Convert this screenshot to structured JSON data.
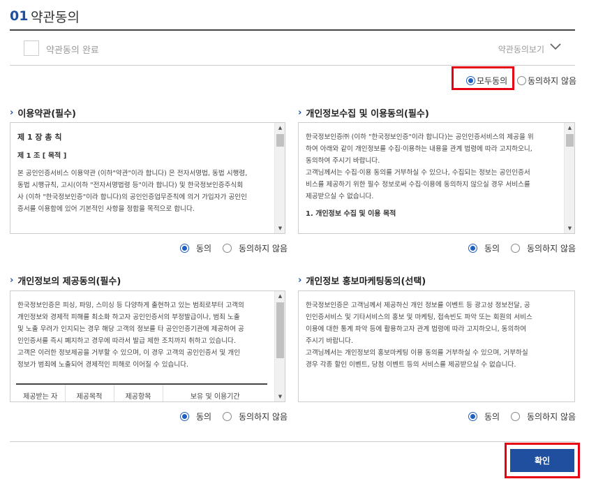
{
  "header": {
    "num": "01",
    "title": "약관동의"
  },
  "agree_row": {
    "label": "약관동의 완료",
    "view_label": "약관동의보기"
  },
  "all": {
    "agree": "모두동의",
    "disagree": "동의하지 않음"
  },
  "terms": {
    "title": "이용약관(필수)",
    "lines": [
      "제 1 장 총 칙",
      "제 1 조 [ 목적 ]",
      "본 공인인증서비스 이용약관 (이하\"약관\"이라 합니다) 은 전자서명법, 동법 시행령,",
      "동법 시행규칙, 고시(이하 \"전자서명법령 등\"이라 합니다) 및 한국정보인증주식회",
      "사 (이하 \"한국정보인증\"이라 합니다)의 공인인증업무준칙에 의거 가입자가 공인인",
      "증서를 이용함에 있어 기본적인 사항을 정함을 목적으로 합니다."
    ],
    "agree": "동의",
    "disagree": "동의하지 않음"
  },
  "privacy": {
    "title": "개인정보수집 및 이용동의(필수)",
    "lines": [
      "한국정보인증㈜ (이하 \"한국정보인증\"이라 합니다)는 공인인증서비스의 제공을 위",
      "하여 아래와 같이 개인정보를 수집·이용하는 내용을 관계 법령에 따라 고지하오니,",
      "동의하여 주시기 바랍니다.",
      "고객님께서는 수집·이용 동의를 거부하실 수 있으나, 수집되는 정보는 공인인증서",
      "비스를 제공하기 위한 필수 정보로써 수집·이용에 동의하지 않으실 경우 서비스를",
      "제공받으실 수 없습니다.",
      "1. 개인정보 수집 및 이용 목적"
    ],
    "agree": "동의",
    "disagree": "동의하지 않음"
  },
  "provision": {
    "title": "개인정보의 제공동의(필수)",
    "lines": [
      "한국정보인증은 피싱, 파밍, 스미싱 등 다양하게 출현하고 있는 범죄로부터 고객의",
      "개인정보와 경제적 피해를 최소화 하고자 공인인증서의 부정발급이나, 범죄 노출",
      "및 노출 우려가 인지되는 경우 해당 고객의 정보를 타 공인인증기관에 제공하여 공",
      "인인증서를 즉시 폐지하고 경우에 따라서 발급 제한 조치까지 취하고 있습니다.",
      "고객은 이러한 정보제공을 거부할 수 있으며, 이 경우 고객의 공인인증서 및 개인",
      "정보가 범죄에 노출되어 경제적인 피해로 이어질 수 있습니다."
    ],
    "table_headers": [
      "제공받는 자",
      "제공목적",
      "제공항목",
      "보유 및 이용기간"
    ],
    "agree": "동의",
    "disagree": "동의하지 않음"
  },
  "marketing": {
    "title": "개인정보 홍보마케팅동의(선택)",
    "lines": [
      "한국정보인증은 고객님께서 제공하신 개인 정보를 이벤트 등 광고성 정보전달, 공",
      "인인증서비스 및 기타서비스의 홍보 및 마케팅, 접속빈도 파악 또는 회원의 서비스",
      "이용에 대한 통계 파악 등에 활용하고자 관계 법령에 따라 고지하오니, 동의하여",
      "주시기 바랍니다.",
      "고객님께서는 개인정보의 홍보마케팅 이용 동의를 거부하실 수 있으며, 거부하실",
      "경우 각종 할인 이벤트, 당첨 이벤트 등의 서비스를 제공받으실 수 없습니다."
    ],
    "agree": "동의",
    "disagree": "동의하지 않음"
  },
  "confirm_label": "확인",
  "colors": {
    "brand": "#1f4f9e",
    "highlight": "#e60012"
  }
}
